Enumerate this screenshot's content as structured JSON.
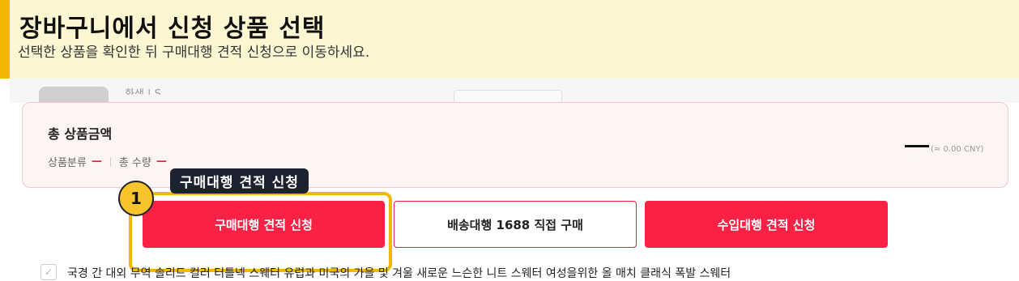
{
  "header": {
    "title": "장바구니에서 신청 상품 선택",
    "subtitle": "선택한 상품을 확인한 뒤 구매대행 견적 신청으로 이동하세요."
  },
  "background_item": {
    "partial_text": "화색 | S"
  },
  "summary": {
    "total_label": "총 상품금액",
    "category_label": "상품분류",
    "category_value": "—",
    "quantity_label": "총 수량",
    "quantity_value": "—",
    "currency_note": "(≈ 0.00 CNY)"
  },
  "actions": {
    "quote_request": "구매대행 견적 신청",
    "direct_purchase": "배송대행 1688 직접 구매",
    "import_quote": "수입대행 견적 신청"
  },
  "guide": {
    "step_number": "1",
    "tooltip": "구매대행 견적 신청",
    "accent_color": "#f2b705"
  },
  "product": {
    "title": "국경 간 대외 무역 솔리드 컬러 터틀넥 스웨터 유럽과 미국의 가을 및 겨울 새로운 느슨한 니트 스웨터 여성을위한 올 매치 클래식 폭발 스웨터"
  },
  "colors": {
    "primary_red": "#fb2144",
    "header_bg": "#fdf6d3",
    "summary_bg": "#fff4f4"
  }
}
